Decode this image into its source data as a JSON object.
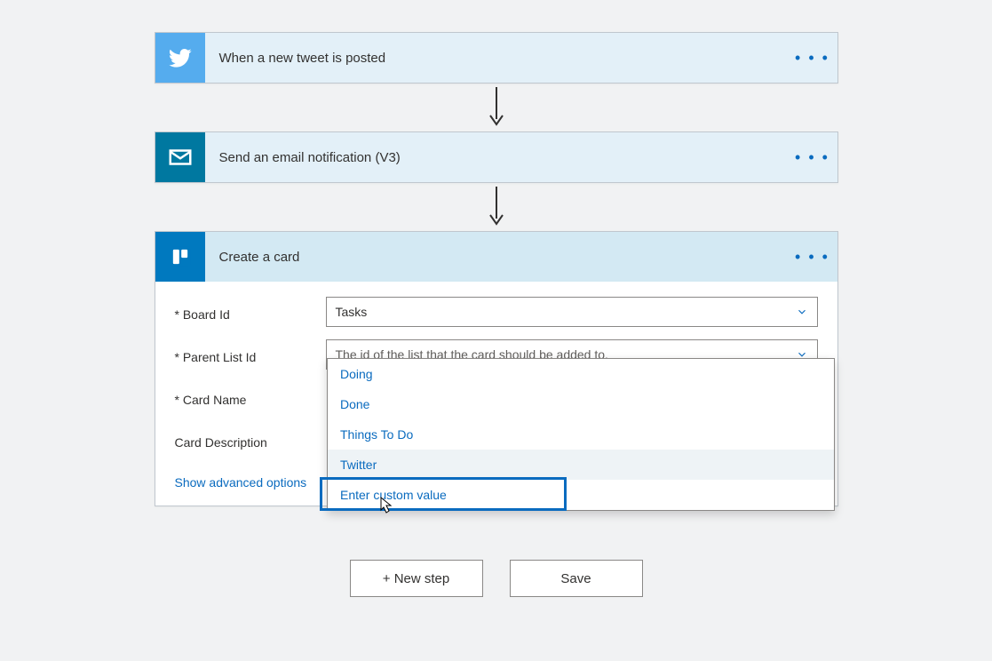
{
  "steps": {
    "trigger": {
      "title": "When a new tweet is posted"
    },
    "action1": {
      "title": "Send an email notification (V3)"
    },
    "action2": {
      "title": "Create a card"
    }
  },
  "form": {
    "boardId": {
      "label": "Board Id",
      "value": "Tasks"
    },
    "parentList": {
      "label": "Parent List Id",
      "placeholder": "The id of the list that the card should be added to."
    },
    "cardName": {
      "label": "Card Name"
    },
    "cardDesc": {
      "label": "Card Description"
    },
    "advanced": "Show advanced options"
  },
  "dropdown": {
    "options": [
      "Doing",
      "Done",
      "Things To Do",
      "Twitter",
      "Enter custom value"
    ],
    "highlighted": "Twitter"
  },
  "buttons": {
    "newStep": "+ New step",
    "save": "Save"
  }
}
